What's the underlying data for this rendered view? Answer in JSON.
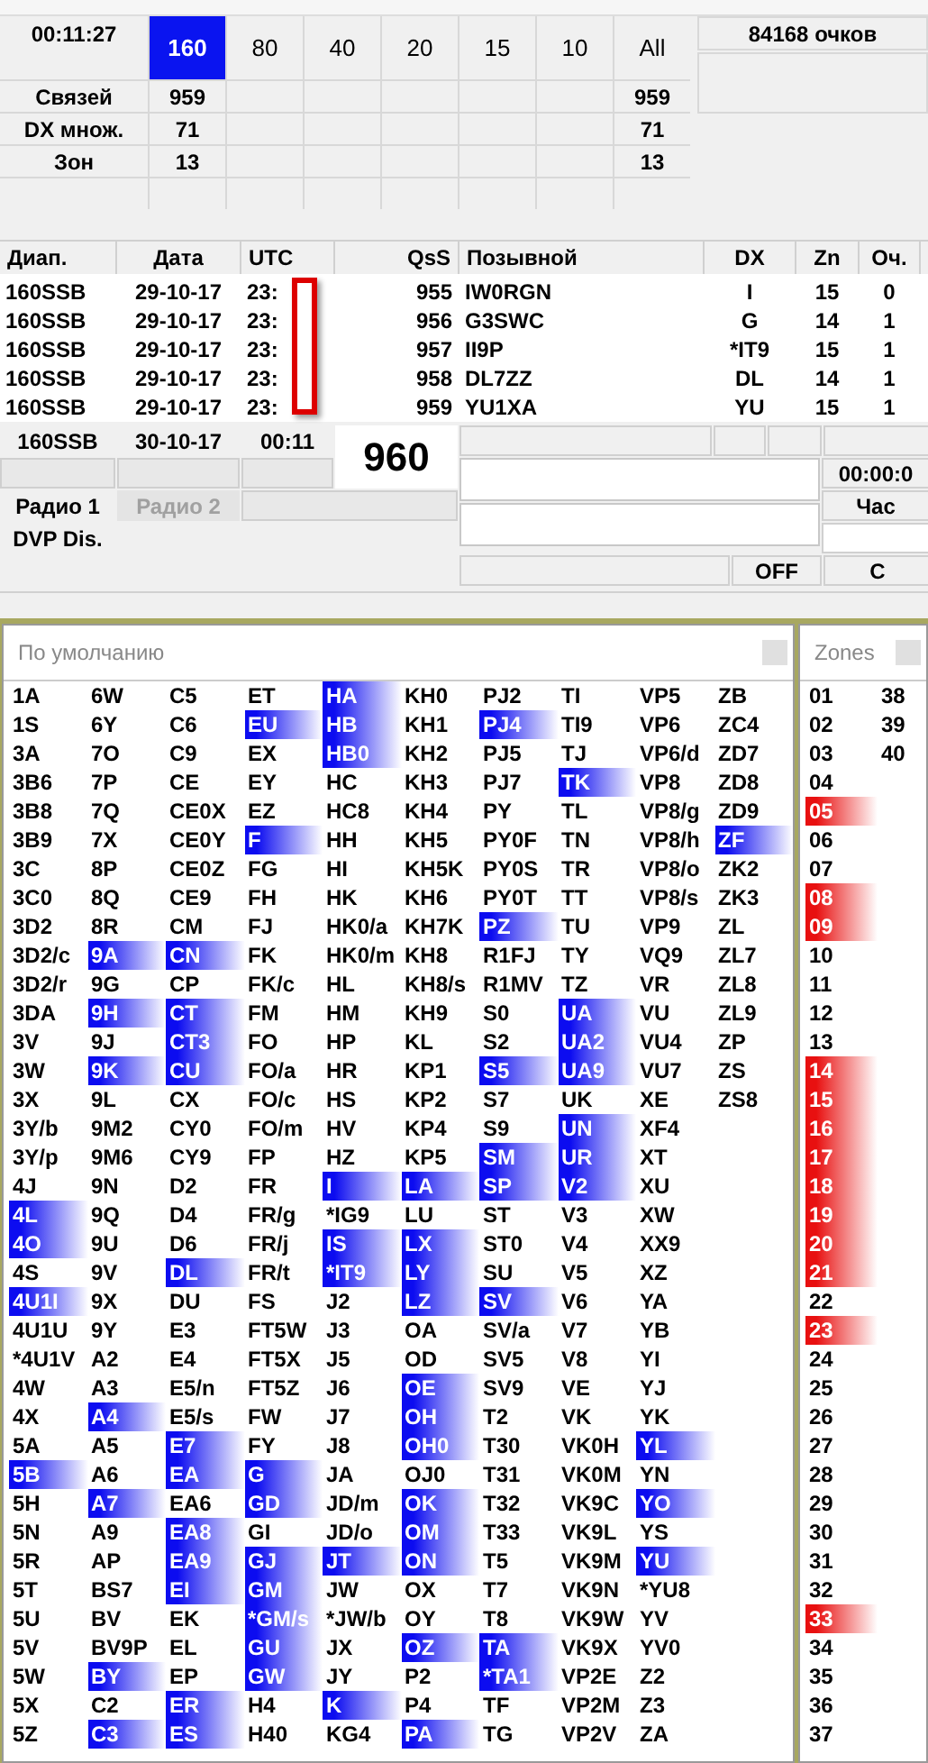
{
  "score": {
    "time": "00:11:27",
    "points": "84168 очков",
    "bands": [
      {
        "label": "160",
        "selected": true
      },
      {
        "label": "80",
        "selected": false
      },
      {
        "label": "40",
        "selected": false
      },
      {
        "label": "20",
        "selected": false
      },
      {
        "label": "15",
        "selected": false
      },
      {
        "label": "10",
        "selected": false
      },
      {
        "label": "All",
        "selected": false
      }
    ],
    "rows": [
      {
        "label": "Связей",
        "value_160": "959",
        "value_all": "959"
      },
      {
        "label": "DX множ.",
        "value_160": "71",
        "value_all": "71"
      },
      {
        "label": "Зон",
        "value_160": "13",
        "value_all": "13"
      }
    ]
  },
  "log": {
    "columns": [
      "Диап.",
      "Дата",
      "UTC",
      "QsS",
      "Позывной",
      "DX",
      "Zn",
      "Оч."
    ],
    "rows": [
      {
        "band": "160SSB",
        "date": "29-10-17",
        "utc": "23:",
        "qso": "955",
        "call": "IW0RGN",
        "dx": "I",
        "zone": "15",
        "points": "0"
      },
      {
        "band": "160SSB",
        "date": "29-10-17",
        "utc": "23:",
        "qso": "956",
        "call": "G3SWC",
        "dx": "G",
        "zone": "14",
        "points": "1"
      },
      {
        "band": "160SSB",
        "date": "29-10-17",
        "utc": "23:",
        "qso": "957",
        "call": "II9P",
        "dx": "*IT9",
        "zone": "15",
        "points": "1"
      },
      {
        "band": "160SSB",
        "date": "29-10-17",
        "utc": "23:",
        "qso": "958",
        "call": "DL7ZZ",
        "dx": "DL",
        "zone": "14",
        "points": "1"
      },
      {
        "band": "160SSB",
        "date": "29-10-17",
        "utc": "23:",
        "qso": "959",
        "call": "YU1XA",
        "dx": "YU",
        "zone": "15",
        "points": "1"
      }
    ]
  },
  "entry": {
    "band": "160SSB",
    "date": "30-10-17",
    "utc": "00:11",
    "qso": "960",
    "radios": [
      {
        "label": "Радио 1",
        "selected": true
      },
      {
        "label": "Радио 2",
        "selected": false
      }
    ],
    "dvp": "DVP Dis.",
    "timer": "00:00:0",
    "hour": "Час",
    "off": "OFF",
    "last": "C"
  },
  "dxcc": {
    "title": "По умолчанию",
    "columns": [
      [
        {
          "prefix": "1A",
          "worked": false
        },
        {
          "prefix": "1S",
          "worked": false
        },
        {
          "prefix": "3A",
          "worked": false
        },
        {
          "prefix": "3B6",
          "worked": false
        },
        {
          "prefix": "3B8",
          "worked": false
        },
        {
          "prefix": "3B9",
          "worked": false
        },
        {
          "prefix": "3C",
          "worked": false
        },
        {
          "prefix": "3C0",
          "worked": false
        },
        {
          "prefix": "3D2",
          "worked": false
        },
        {
          "prefix": "3D2/c",
          "worked": false
        },
        {
          "prefix": "3D2/r",
          "worked": false
        },
        {
          "prefix": "3DA",
          "worked": false
        },
        {
          "prefix": "3V",
          "worked": false
        },
        {
          "prefix": "3W",
          "worked": false
        },
        {
          "prefix": "3X",
          "worked": false
        },
        {
          "prefix": "3Y/b",
          "worked": false
        },
        {
          "prefix": "3Y/p",
          "worked": false
        },
        {
          "prefix": "4J",
          "worked": false
        },
        {
          "prefix": "4L",
          "worked": true
        },
        {
          "prefix": "4O",
          "worked": true
        },
        {
          "prefix": "4S",
          "worked": false
        },
        {
          "prefix": "4U1I",
          "worked": true
        },
        {
          "prefix": "4U1U",
          "worked": false
        },
        {
          "prefix": "*4U1V",
          "worked": false
        },
        {
          "prefix": "4W",
          "worked": false
        },
        {
          "prefix": "4X",
          "worked": false
        },
        {
          "prefix": "5A",
          "worked": false
        },
        {
          "prefix": "5B",
          "worked": true
        },
        {
          "prefix": "5H",
          "worked": false
        },
        {
          "prefix": "5N",
          "worked": false
        },
        {
          "prefix": "5R",
          "worked": false
        },
        {
          "prefix": "5T",
          "worked": false
        },
        {
          "prefix": "5U",
          "worked": false
        },
        {
          "prefix": "5V",
          "worked": false
        },
        {
          "prefix": "5W",
          "worked": false
        },
        {
          "prefix": "5X",
          "worked": false
        },
        {
          "prefix": "5Z",
          "worked": false
        }
      ],
      [
        {
          "prefix": "6W",
          "worked": false
        },
        {
          "prefix": "6Y",
          "worked": false
        },
        {
          "prefix": "7O",
          "worked": false
        },
        {
          "prefix": "7P",
          "worked": false
        },
        {
          "prefix": "7Q",
          "worked": false
        },
        {
          "prefix": "7X",
          "worked": false
        },
        {
          "prefix": "8P",
          "worked": false
        },
        {
          "prefix": "8Q",
          "worked": false
        },
        {
          "prefix": "8R",
          "worked": false
        },
        {
          "prefix": "9A",
          "worked": true
        },
        {
          "prefix": "9G",
          "worked": false
        },
        {
          "prefix": "9H",
          "worked": true
        },
        {
          "prefix": "9J",
          "worked": false
        },
        {
          "prefix": "9K",
          "worked": true
        },
        {
          "prefix": "9L",
          "worked": false
        },
        {
          "prefix": "9M2",
          "worked": false
        },
        {
          "prefix": "9M6",
          "worked": false
        },
        {
          "prefix": "9N",
          "worked": false
        },
        {
          "prefix": "9Q",
          "worked": false
        },
        {
          "prefix": "9U",
          "worked": false
        },
        {
          "prefix": "9V",
          "worked": false
        },
        {
          "prefix": "9X",
          "worked": false
        },
        {
          "prefix": "9Y",
          "worked": false
        },
        {
          "prefix": "A2",
          "worked": false
        },
        {
          "prefix": "A3",
          "worked": false
        },
        {
          "prefix": "A4",
          "worked": true
        },
        {
          "prefix": "A5",
          "worked": false
        },
        {
          "prefix": "A6",
          "worked": false
        },
        {
          "prefix": "A7",
          "worked": true
        },
        {
          "prefix": "A9",
          "worked": false
        },
        {
          "prefix": "AP",
          "worked": false
        },
        {
          "prefix": "BS7",
          "worked": false
        },
        {
          "prefix": "BV",
          "worked": false
        },
        {
          "prefix": "BV9P",
          "worked": false
        },
        {
          "prefix": "BY",
          "worked": true
        },
        {
          "prefix": "C2",
          "worked": false
        },
        {
          "prefix": "C3",
          "worked": true
        }
      ],
      [
        {
          "prefix": "C5",
          "worked": false
        },
        {
          "prefix": "C6",
          "worked": false
        },
        {
          "prefix": "C9",
          "worked": false
        },
        {
          "prefix": "CE",
          "worked": false
        },
        {
          "prefix": "CE0X",
          "worked": false
        },
        {
          "prefix": "CE0Y",
          "worked": false
        },
        {
          "prefix": "CE0Z",
          "worked": false
        },
        {
          "prefix": "CE9",
          "worked": false
        },
        {
          "prefix": "CM",
          "worked": false
        },
        {
          "prefix": "CN",
          "worked": true
        },
        {
          "prefix": "CP",
          "worked": false
        },
        {
          "prefix": "CT",
          "worked": true
        },
        {
          "prefix": "CT3",
          "worked": true
        },
        {
          "prefix": "CU",
          "worked": true
        },
        {
          "prefix": "CX",
          "worked": false
        },
        {
          "prefix": "CY0",
          "worked": false
        },
        {
          "prefix": "CY9",
          "worked": false
        },
        {
          "prefix": "D2",
          "worked": false
        },
        {
          "prefix": "D4",
          "worked": false
        },
        {
          "prefix": "D6",
          "worked": false
        },
        {
          "prefix": "DL",
          "worked": true
        },
        {
          "prefix": "DU",
          "worked": false
        },
        {
          "prefix": "E3",
          "worked": false
        },
        {
          "prefix": "E4",
          "worked": false
        },
        {
          "prefix": "E5/n",
          "worked": false
        },
        {
          "prefix": "E5/s",
          "worked": false
        },
        {
          "prefix": "E7",
          "worked": true
        },
        {
          "prefix": "EA",
          "worked": true
        },
        {
          "prefix": "EA6",
          "worked": false
        },
        {
          "prefix": "EA8",
          "worked": true
        },
        {
          "prefix": "EA9",
          "worked": true
        },
        {
          "prefix": "EI",
          "worked": true
        },
        {
          "prefix": "EK",
          "worked": false
        },
        {
          "prefix": "EL",
          "worked": false
        },
        {
          "prefix": "EP",
          "worked": false
        },
        {
          "prefix": "ER",
          "worked": true
        },
        {
          "prefix": "ES",
          "worked": true
        }
      ],
      [
        {
          "prefix": "ET",
          "worked": false
        },
        {
          "prefix": "EU",
          "worked": true
        },
        {
          "prefix": "EX",
          "worked": false
        },
        {
          "prefix": "EY",
          "worked": false
        },
        {
          "prefix": "EZ",
          "worked": false
        },
        {
          "prefix": "F",
          "worked": true
        },
        {
          "prefix": "FG",
          "worked": false
        },
        {
          "prefix": "FH",
          "worked": false
        },
        {
          "prefix": "FJ",
          "worked": false
        },
        {
          "prefix": "FK",
          "worked": false
        },
        {
          "prefix": "FK/c",
          "worked": false
        },
        {
          "prefix": "FM",
          "worked": false
        },
        {
          "prefix": "FO",
          "worked": false
        },
        {
          "prefix": "FO/a",
          "worked": false
        },
        {
          "prefix": "FO/c",
          "worked": false
        },
        {
          "prefix": "FO/m",
          "worked": false
        },
        {
          "prefix": "FP",
          "worked": false
        },
        {
          "prefix": "FR",
          "worked": false
        },
        {
          "prefix": "FR/g",
          "worked": false
        },
        {
          "prefix": "FR/j",
          "worked": false
        },
        {
          "prefix": "FR/t",
          "worked": false
        },
        {
          "prefix": "FS",
          "worked": false
        },
        {
          "prefix": "FT5W",
          "worked": false
        },
        {
          "prefix": "FT5X",
          "worked": false
        },
        {
          "prefix": "FT5Z",
          "worked": false
        },
        {
          "prefix": "FW",
          "worked": false
        },
        {
          "prefix": "FY",
          "worked": false
        },
        {
          "prefix": "G",
          "worked": true
        },
        {
          "prefix": "GD",
          "worked": true
        },
        {
          "prefix": "GI",
          "worked": false
        },
        {
          "prefix": "GJ",
          "worked": true
        },
        {
          "prefix": "GM",
          "worked": true
        },
        {
          "prefix": "*GM/s",
          "worked": true
        },
        {
          "prefix": "GU",
          "worked": true
        },
        {
          "prefix": "GW",
          "worked": true
        },
        {
          "prefix": "H4",
          "worked": false
        },
        {
          "prefix": "H40",
          "worked": false
        }
      ],
      [
        {
          "prefix": "HA",
          "worked": true
        },
        {
          "prefix": "HB",
          "worked": true
        },
        {
          "prefix": "HB0",
          "worked": true
        },
        {
          "prefix": "HC",
          "worked": false
        },
        {
          "prefix": "HC8",
          "worked": false
        },
        {
          "prefix": "HH",
          "worked": false
        },
        {
          "prefix": "HI",
          "worked": false
        },
        {
          "prefix": "HK",
          "worked": false
        },
        {
          "prefix": "HK0/a",
          "worked": false
        },
        {
          "prefix": "HK0/m",
          "worked": false
        },
        {
          "prefix": "HL",
          "worked": false
        },
        {
          "prefix": "HM",
          "worked": false
        },
        {
          "prefix": "HP",
          "worked": false
        },
        {
          "prefix": "HR",
          "worked": false
        },
        {
          "prefix": "HS",
          "worked": false
        },
        {
          "prefix": "HV",
          "worked": false
        },
        {
          "prefix": "HZ",
          "worked": false
        },
        {
          "prefix": "I",
          "worked": true
        },
        {
          "prefix": "*IG9",
          "worked": false
        },
        {
          "prefix": "IS",
          "worked": true
        },
        {
          "prefix": "*IT9",
          "worked": true
        },
        {
          "prefix": "J2",
          "worked": false
        },
        {
          "prefix": "J3",
          "worked": false
        },
        {
          "prefix": "J5",
          "worked": false
        },
        {
          "prefix": "J6",
          "worked": false
        },
        {
          "prefix": "J7",
          "worked": false
        },
        {
          "prefix": "J8",
          "worked": false
        },
        {
          "prefix": "JA",
          "worked": false
        },
        {
          "prefix": "JD/m",
          "worked": false
        },
        {
          "prefix": "JD/o",
          "worked": false
        },
        {
          "prefix": "JT",
          "worked": true
        },
        {
          "prefix": "JW",
          "worked": false
        },
        {
          "prefix": "*JW/b",
          "worked": false
        },
        {
          "prefix": "JX",
          "worked": false
        },
        {
          "prefix": "JY",
          "worked": false
        },
        {
          "prefix": "K",
          "worked": true
        },
        {
          "prefix": "KG4",
          "worked": false
        }
      ],
      [
        {
          "prefix": "KH0",
          "worked": false
        },
        {
          "prefix": "KH1",
          "worked": false
        },
        {
          "prefix": "KH2",
          "worked": false
        },
        {
          "prefix": "KH3",
          "worked": false
        },
        {
          "prefix": "KH4",
          "worked": false
        },
        {
          "prefix": "KH5",
          "worked": false
        },
        {
          "prefix": "KH5K",
          "worked": false
        },
        {
          "prefix": "KH6",
          "worked": false
        },
        {
          "prefix": "KH7K",
          "worked": false
        },
        {
          "prefix": "KH8",
          "worked": false
        },
        {
          "prefix": "KH8/s",
          "worked": false
        },
        {
          "prefix": "KH9",
          "worked": false
        },
        {
          "prefix": "KL",
          "worked": false
        },
        {
          "prefix": "KP1",
          "worked": false
        },
        {
          "prefix": "KP2",
          "worked": false
        },
        {
          "prefix": "KP4",
          "worked": false
        },
        {
          "prefix": "KP5",
          "worked": false
        },
        {
          "prefix": "LA",
          "worked": true
        },
        {
          "prefix": "LU",
          "worked": false
        },
        {
          "prefix": "LX",
          "worked": true
        },
        {
          "prefix": "LY",
          "worked": true
        },
        {
          "prefix": "LZ",
          "worked": true
        },
        {
          "prefix": "OA",
          "worked": false
        },
        {
          "prefix": "OD",
          "worked": false
        },
        {
          "prefix": "OE",
          "worked": true
        },
        {
          "prefix": "OH",
          "worked": true
        },
        {
          "prefix": "OH0",
          "worked": true
        },
        {
          "prefix": "OJ0",
          "worked": false
        },
        {
          "prefix": "OK",
          "worked": true
        },
        {
          "prefix": "OM",
          "worked": true
        },
        {
          "prefix": "ON",
          "worked": true
        },
        {
          "prefix": "OX",
          "worked": false
        },
        {
          "prefix": "OY",
          "worked": false
        },
        {
          "prefix": "OZ",
          "worked": true
        },
        {
          "prefix": "P2",
          "worked": false
        },
        {
          "prefix": "P4",
          "worked": false
        },
        {
          "prefix": "PA",
          "worked": true
        }
      ],
      [
        {
          "prefix": "PJ2",
          "worked": false
        },
        {
          "prefix": "PJ4",
          "worked": true
        },
        {
          "prefix": "PJ5",
          "worked": false
        },
        {
          "prefix": "PJ7",
          "worked": false
        },
        {
          "prefix": "PY",
          "worked": false
        },
        {
          "prefix": "PY0F",
          "worked": false
        },
        {
          "prefix": "PY0S",
          "worked": false
        },
        {
          "prefix": "PY0T",
          "worked": false
        },
        {
          "prefix": "PZ",
          "worked": true
        },
        {
          "prefix": "R1FJ",
          "worked": false
        },
        {
          "prefix": "R1MV",
          "worked": false
        },
        {
          "prefix": "S0",
          "worked": false
        },
        {
          "prefix": "S2",
          "worked": false
        },
        {
          "prefix": "S5",
          "worked": true
        },
        {
          "prefix": "S7",
          "worked": false
        },
        {
          "prefix": "S9",
          "worked": false
        },
        {
          "prefix": "SM",
          "worked": true
        },
        {
          "prefix": "SP",
          "worked": true
        },
        {
          "prefix": "ST",
          "worked": false
        },
        {
          "prefix": "ST0",
          "worked": false
        },
        {
          "prefix": "SU",
          "worked": false
        },
        {
          "prefix": "SV",
          "worked": true
        },
        {
          "prefix": "SV/a",
          "worked": false
        },
        {
          "prefix": "SV5",
          "worked": false
        },
        {
          "prefix": "SV9",
          "worked": false
        },
        {
          "prefix": "T2",
          "worked": false
        },
        {
          "prefix": "T30",
          "worked": false
        },
        {
          "prefix": "T31",
          "worked": false
        },
        {
          "prefix": "T32",
          "worked": false
        },
        {
          "prefix": "T33",
          "worked": false
        },
        {
          "prefix": "T5",
          "worked": false
        },
        {
          "prefix": "T7",
          "worked": false
        },
        {
          "prefix": "T8",
          "worked": false
        },
        {
          "prefix": "TA",
          "worked": true
        },
        {
          "prefix": "*TA1",
          "worked": true
        },
        {
          "prefix": "TF",
          "worked": false
        },
        {
          "prefix": "TG",
          "worked": false
        }
      ],
      [
        {
          "prefix": "TI",
          "worked": false
        },
        {
          "prefix": "TI9",
          "worked": false
        },
        {
          "prefix": "TJ",
          "worked": false
        },
        {
          "prefix": "TK",
          "worked": true
        },
        {
          "prefix": "TL",
          "worked": false
        },
        {
          "prefix": "TN",
          "worked": false
        },
        {
          "prefix": "TR",
          "worked": false
        },
        {
          "prefix": "TT",
          "worked": false
        },
        {
          "prefix": "TU",
          "worked": false
        },
        {
          "prefix": "TY",
          "worked": false
        },
        {
          "prefix": "TZ",
          "worked": false
        },
        {
          "prefix": "UA",
          "worked": true
        },
        {
          "prefix": "UA2",
          "worked": true
        },
        {
          "prefix": "UA9",
          "worked": true
        },
        {
          "prefix": "UK",
          "worked": false
        },
        {
          "prefix": "UN",
          "worked": true
        },
        {
          "prefix": "UR",
          "worked": true
        },
        {
          "prefix": "V2",
          "worked": true
        },
        {
          "prefix": "V3",
          "worked": false
        },
        {
          "prefix": "V4",
          "worked": false
        },
        {
          "prefix": "V5",
          "worked": false
        },
        {
          "prefix": "V6",
          "worked": false
        },
        {
          "prefix": "V7",
          "worked": false
        },
        {
          "prefix": "V8",
          "worked": false
        },
        {
          "prefix": "VE",
          "worked": false
        },
        {
          "prefix": "VK",
          "worked": false
        },
        {
          "prefix": "VK0H",
          "worked": false
        },
        {
          "prefix": "VK0M",
          "worked": false
        },
        {
          "prefix": "VK9C",
          "worked": false
        },
        {
          "prefix": "VK9L",
          "worked": false
        },
        {
          "prefix": "VK9M",
          "worked": false
        },
        {
          "prefix": "VK9N",
          "worked": false
        },
        {
          "prefix": "VK9W",
          "worked": false
        },
        {
          "prefix": "VK9X",
          "worked": false
        },
        {
          "prefix": "VP2E",
          "worked": false
        },
        {
          "prefix": "VP2M",
          "worked": false
        },
        {
          "prefix": "VP2V",
          "worked": false
        }
      ],
      [
        {
          "prefix": "VP5",
          "worked": false
        },
        {
          "prefix": "VP6",
          "worked": false
        },
        {
          "prefix": "VP6/d",
          "worked": false
        },
        {
          "prefix": "VP8",
          "worked": false
        },
        {
          "prefix": "VP8/g",
          "worked": false
        },
        {
          "prefix": "VP8/h",
          "worked": false
        },
        {
          "prefix": "VP8/o",
          "worked": false
        },
        {
          "prefix": "VP8/s",
          "worked": false
        },
        {
          "prefix": "VP9",
          "worked": false
        },
        {
          "prefix": "VQ9",
          "worked": false
        },
        {
          "prefix": "VR",
          "worked": false
        },
        {
          "prefix": "VU",
          "worked": false
        },
        {
          "prefix": "VU4",
          "worked": false
        },
        {
          "prefix": "VU7",
          "worked": false
        },
        {
          "prefix": "XE",
          "worked": false
        },
        {
          "prefix": "XF4",
          "worked": false
        },
        {
          "prefix": "XT",
          "worked": false
        },
        {
          "prefix": "XU",
          "worked": false
        },
        {
          "prefix": "XW",
          "worked": false
        },
        {
          "prefix": "XX9",
          "worked": false
        },
        {
          "prefix": "XZ",
          "worked": false
        },
        {
          "prefix": "YA",
          "worked": false
        },
        {
          "prefix": "YB",
          "worked": false
        },
        {
          "prefix": "YI",
          "worked": false
        },
        {
          "prefix": "YJ",
          "worked": false
        },
        {
          "prefix": "YK",
          "worked": false
        },
        {
          "prefix": "YL",
          "worked": true
        },
        {
          "prefix": "YN",
          "worked": false
        },
        {
          "prefix": "YO",
          "worked": true
        },
        {
          "prefix": "YS",
          "worked": false
        },
        {
          "prefix": "YU",
          "worked": true
        },
        {
          "prefix": "*YU8",
          "worked": false
        },
        {
          "prefix": "YV",
          "worked": false
        },
        {
          "prefix": "YV0",
          "worked": false
        },
        {
          "prefix": "Z2",
          "worked": false
        },
        {
          "prefix": "Z3",
          "worked": false
        },
        {
          "prefix": "ZA",
          "worked": false
        }
      ],
      [
        {
          "prefix": "ZB",
          "worked": false
        },
        {
          "prefix": "ZC4",
          "worked": false
        },
        {
          "prefix": "ZD7",
          "worked": false
        },
        {
          "prefix": "ZD8",
          "worked": false
        },
        {
          "prefix": "ZD9",
          "worked": false
        },
        {
          "prefix": "ZF",
          "worked": true
        },
        {
          "prefix": "ZK2",
          "worked": false
        },
        {
          "prefix": "ZK3",
          "worked": false
        },
        {
          "prefix": "ZL",
          "worked": false
        },
        {
          "prefix": "ZL7",
          "worked": false
        },
        {
          "prefix": "ZL8",
          "worked": false
        },
        {
          "prefix": "ZL9",
          "worked": false
        },
        {
          "prefix": "ZP",
          "worked": false
        },
        {
          "prefix": "ZS",
          "worked": false
        },
        {
          "prefix": "ZS8",
          "worked": false
        }
      ]
    ]
  },
  "zones": {
    "title": "Zones",
    "columns": [
      [
        {
          "zone": "01",
          "worked": false
        },
        {
          "zone": "02",
          "worked": false
        },
        {
          "zone": "03",
          "worked": false
        },
        {
          "zone": "04",
          "worked": false
        },
        {
          "zone": "05",
          "worked": true
        },
        {
          "zone": "06",
          "worked": false
        },
        {
          "zone": "07",
          "worked": false
        },
        {
          "zone": "08",
          "worked": true
        },
        {
          "zone": "09",
          "worked": true
        },
        {
          "zone": "10",
          "worked": false
        },
        {
          "zone": "11",
          "worked": false
        },
        {
          "zone": "12",
          "worked": false
        },
        {
          "zone": "13",
          "worked": false
        },
        {
          "zone": "14",
          "worked": true
        },
        {
          "zone": "15",
          "worked": true
        },
        {
          "zone": "16",
          "worked": true
        },
        {
          "zone": "17",
          "worked": true
        },
        {
          "zone": "18",
          "worked": true
        },
        {
          "zone": "19",
          "worked": true
        },
        {
          "zone": "20",
          "worked": true
        },
        {
          "zone": "21",
          "worked": true
        },
        {
          "zone": "22",
          "worked": false
        },
        {
          "zone": "23",
          "worked": true
        },
        {
          "zone": "24",
          "worked": false
        },
        {
          "zone": "25",
          "worked": false
        },
        {
          "zone": "26",
          "worked": false
        },
        {
          "zone": "27",
          "worked": false
        },
        {
          "zone": "28",
          "worked": false
        },
        {
          "zone": "29",
          "worked": false
        },
        {
          "zone": "30",
          "worked": false
        },
        {
          "zone": "31",
          "worked": false
        },
        {
          "zone": "32",
          "worked": false
        },
        {
          "zone": "33",
          "worked": true
        },
        {
          "zone": "34",
          "worked": false
        },
        {
          "zone": "35",
          "worked": false
        },
        {
          "zone": "36",
          "worked": false
        },
        {
          "zone": "37",
          "worked": false
        }
      ],
      [
        {
          "zone": "38",
          "worked": false
        },
        {
          "zone": "39",
          "worked": false
        },
        {
          "zone": "40",
          "worked": false
        }
      ]
    ]
  }
}
